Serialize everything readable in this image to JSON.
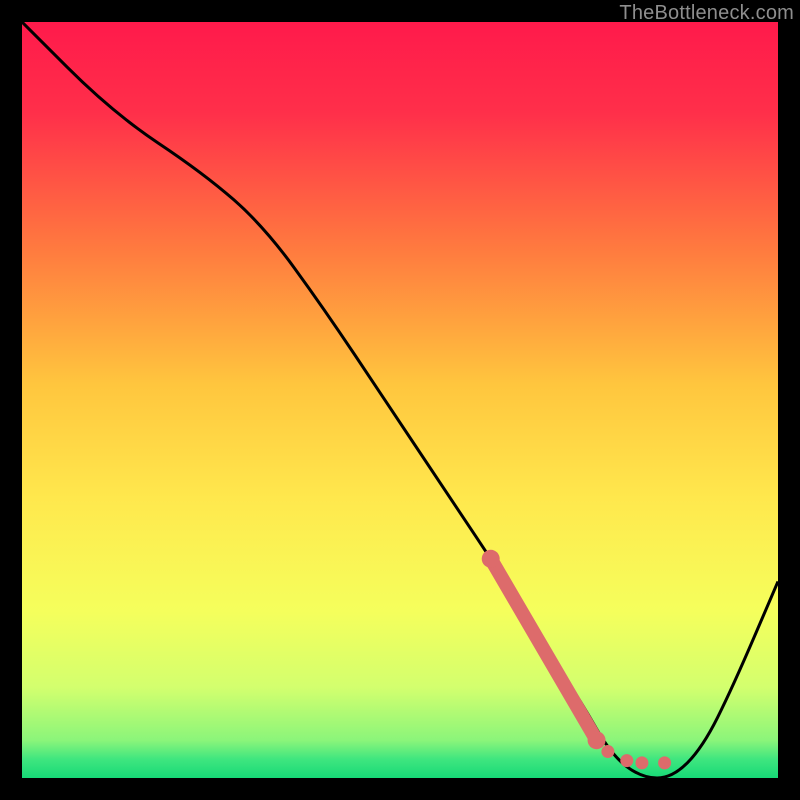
{
  "watermark": "TheBottleneck.com",
  "chart_data": {
    "type": "line",
    "title": "",
    "xlabel": "",
    "ylabel": "",
    "xlim": [
      0,
      100
    ],
    "ylim": [
      0,
      100
    ],
    "grid": false,
    "legend": false,
    "background_gradient": {
      "top": "#ff1a4b",
      "mid_upper": "#ff944d",
      "mid": "#ffe84d",
      "mid_lower": "#e8ff66",
      "bottom": "#1fe07a"
    },
    "series": [
      {
        "name": "bottleneck-curve",
        "color": "#000000",
        "x": [
          0,
          12,
          24,
          32,
          40,
          48,
          56,
          64,
          70,
          74,
          78,
          82,
          86,
          90,
          94,
          100
        ],
        "y": [
          100,
          88,
          80,
          73,
          62,
          50,
          38,
          26,
          16,
          10,
          3,
          0,
          0,
          4,
          12,
          26
        ]
      }
    ],
    "highlight_segment": {
      "name": "recommended-range",
      "color": "#dd6b6b",
      "cap_color": "#dd6b6b",
      "x": [
        62,
        76
      ],
      "y": [
        29,
        5
      ],
      "dots": [
        {
          "x": 77.5,
          "y": 3.5
        },
        {
          "x": 80,
          "y": 2.3
        },
        {
          "x": 82,
          "y": 2.0
        },
        {
          "x": 85,
          "y": 2.0
        }
      ]
    }
  }
}
